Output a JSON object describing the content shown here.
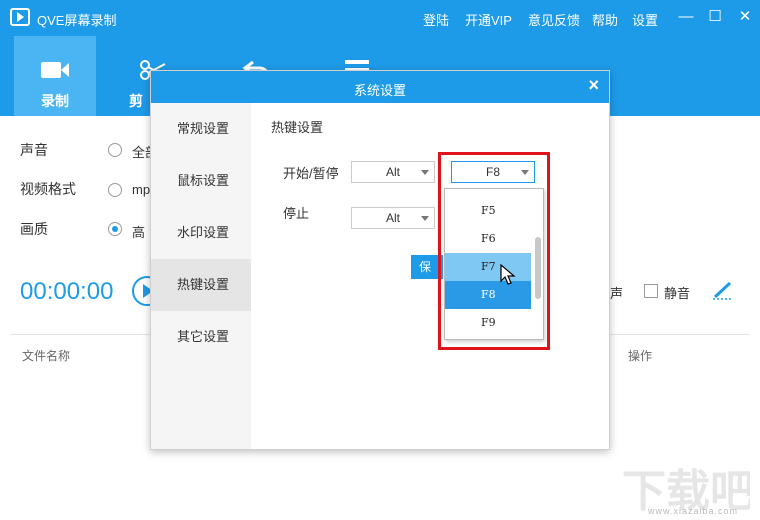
{
  "app": {
    "title": "QVE屏幕录制",
    "top_links": [
      "登陆",
      "开通VIP",
      "意见反馈",
      "帮助",
      "设置"
    ],
    "window_buttons": [
      "minimize-icon",
      "maximize-icon",
      "close-icon"
    ]
  },
  "nav": {
    "items": [
      {
        "label": "录制",
        "icon": "video-camera-icon",
        "active": true
      },
      {
        "label": "剪",
        "icon": "scissors-icon",
        "active": false
      },
      {
        "label": "",
        "icon": "undo-icon",
        "active": false
      },
      {
        "label": "",
        "icon": "list-icon",
        "active": false
      }
    ]
  },
  "settings": {
    "audio_label": "声音",
    "audio_option": "全部",
    "format_label": "视频格式",
    "format_option": "mp",
    "quality_label": "画质",
    "quality_option": "高"
  },
  "recorder": {
    "timer": "00:00:00",
    "sound_label": "声",
    "mute_label": "静音"
  },
  "file_table": {
    "col_filename": "文件名称",
    "col_action": "操作"
  },
  "dialog": {
    "title": "系统设置",
    "close": "×",
    "sidebar": [
      "常规设置",
      "鼠标设置",
      "水印设置",
      "热键设置",
      "其它设置"
    ],
    "active_tab": "热键设置",
    "heading": "热键设置",
    "start_stop_label": "开始/暂停",
    "stop_label": "停止",
    "start_modifier": "Alt",
    "start_key": "F8",
    "stop_modifier": "Alt",
    "save_label": "保"
  },
  "dropdown": {
    "items": [
      "F5",
      "F6",
      "F7",
      "F8",
      "F9"
    ],
    "hovered": "F7",
    "selected": "F8"
  },
  "watermark": {
    "text": "下载吧",
    "url": "www.xiazaiba.com"
  },
  "colors": {
    "accent": "#1e9be8",
    "highlight_border": "#e0121b",
    "dropdown_selected": "#2b9ae6",
    "dropdown_hover": "#7fc8f4"
  }
}
